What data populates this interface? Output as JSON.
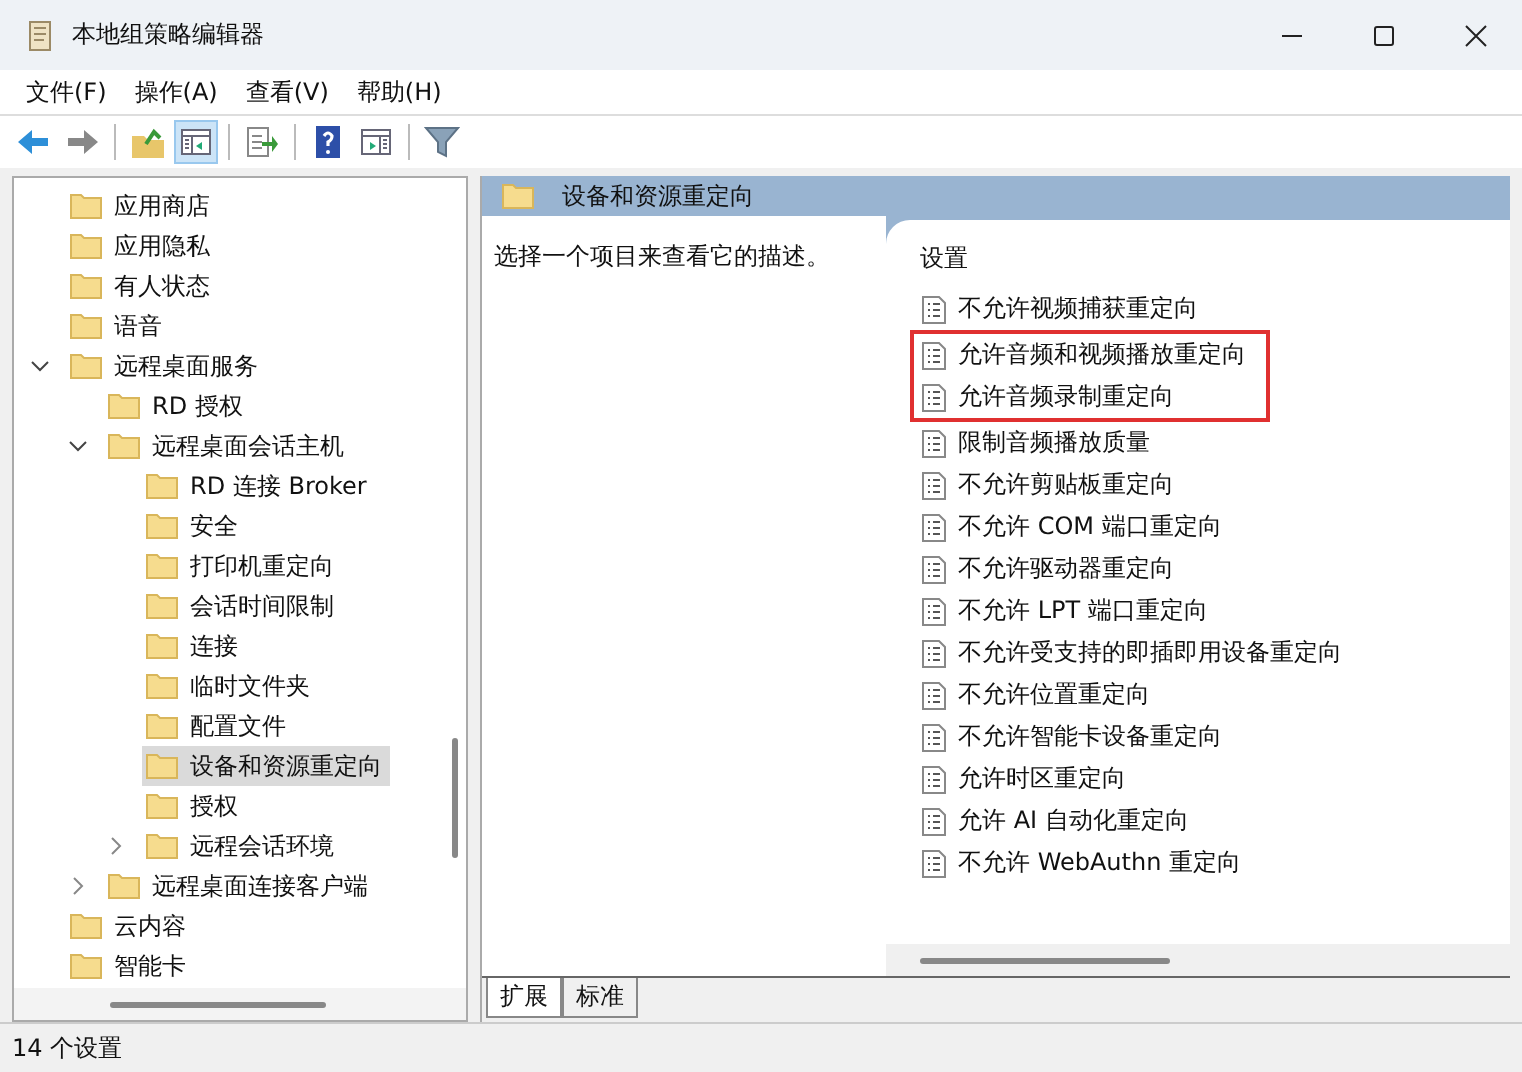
{
  "window": {
    "title": "本地组策略编辑器"
  },
  "menu": [
    "文件(F)",
    "操作(A)",
    "查看(V)",
    "帮助(H)"
  ],
  "toolbar": [
    {
      "kind": "back",
      "pressed": false
    },
    {
      "kind": "forward",
      "pressed": false
    },
    {
      "kind": "sep"
    },
    {
      "kind": "up",
      "pressed": false
    },
    {
      "kind": "tree",
      "pressed": true
    },
    {
      "kind": "sep"
    },
    {
      "kind": "export",
      "pressed": false
    },
    {
      "kind": "sep"
    },
    {
      "kind": "help",
      "pressed": false
    },
    {
      "kind": "panel",
      "pressed": false
    },
    {
      "kind": "sep"
    },
    {
      "kind": "filter",
      "pressed": false
    }
  ],
  "tree": [
    {
      "label": "应用商店",
      "selected": false
    },
    {
      "label": "应用隐私",
      "selected": false
    },
    {
      "label": "有人状态",
      "selected": false
    },
    {
      "label": "语音",
      "selected": false
    },
    {
      "label": "远程桌面服务",
      "selected": false,
      "expanded": true,
      "children": [
        {
          "label": "RD 授权",
          "selected": false
        },
        {
          "label": "远程桌面会话主机",
          "selected": false,
          "expanded": true,
          "children": [
            {
              "label": "RD 连接 Broker",
              "selected": false
            },
            {
              "label": "安全",
              "selected": false
            },
            {
              "label": "打印机重定向",
              "selected": false
            },
            {
              "label": "会话时间限制",
              "selected": false
            },
            {
              "label": "连接",
              "selected": false
            },
            {
              "label": "临时文件夹",
              "selected": false
            },
            {
              "label": "配置文件",
              "selected": false
            },
            {
              "label": "设备和资源重定向",
              "selected": true
            },
            {
              "label": "授权",
              "selected": false
            },
            {
              "label": "远程会话环境",
              "selected": false,
              "expanded": false
            }
          ]
        },
        {
          "label": "远程桌面连接客户端",
          "selected": false,
          "expanded": false
        }
      ]
    },
    {
      "label": "云内容",
      "selected": false
    },
    {
      "label": "智能卡",
      "selected": false
    }
  ],
  "details": {
    "title": "设备和资源重定向",
    "description": "选择一个项目来查看它的描述。",
    "column": "设置",
    "settings": [
      {
        "label": "不允许视频捕获重定向",
        "highlighted": false
      },
      {
        "label": "允许音频和视频播放重定向",
        "highlighted": true
      },
      {
        "label": "允许音频录制重定向",
        "highlighted": true
      },
      {
        "label": "限制音频播放质量",
        "highlighted": false
      },
      {
        "label": "不允许剪贴板重定向",
        "highlighted": false
      },
      {
        "label": "不允许 COM 端口重定向",
        "highlighted": false
      },
      {
        "label": "不允许驱动器重定向",
        "highlighted": false
      },
      {
        "label": "不允许 LPT 端口重定向",
        "highlighted": false
      },
      {
        "label": "不允许受支持的即插即用设备重定向",
        "highlighted": false
      },
      {
        "label": "不允许位置重定向",
        "highlighted": false
      },
      {
        "label": "不允许智能卡设备重定向",
        "highlighted": false
      },
      {
        "label": "允许时区重定向",
        "highlighted": false
      },
      {
        "label": "允许 AI 自动化重定向",
        "highlighted": false
      },
      {
        "label": "不允许 WebAuthn 重定向",
        "highlighted": false
      }
    ]
  },
  "tabs": [
    {
      "label": "扩展",
      "selected": true
    },
    {
      "label": "标准",
      "selected": false
    }
  ],
  "status_bar": "14 个设置"
}
